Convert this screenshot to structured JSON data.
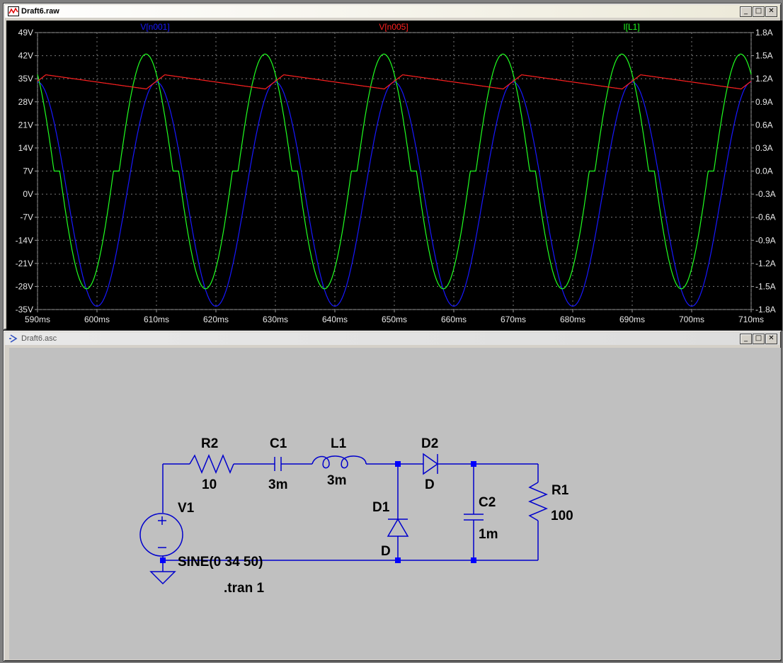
{
  "waveform_window": {
    "title": "Draft6.raw",
    "buttons": {
      "minimize": "_",
      "maximize": "□",
      "close": "✕"
    },
    "traces": [
      {
        "name": "V[n001]",
        "color": "#1818ff"
      },
      {
        "name": "V[n005]",
        "color": "#ff2020"
      },
      {
        "name": "I[L1]",
        "color": "#20ff20"
      }
    ],
    "chart_data": {
      "type": "line",
      "x_ticks": [
        "590ms",
        "600ms",
        "610ms",
        "620ms",
        "630ms",
        "640ms",
        "650ms",
        "660ms",
        "670ms",
        "680ms",
        "690ms",
        "700ms",
        "710ms"
      ],
      "xlim_ms": [
        590,
        710
      ],
      "left_ticks": [
        "49V",
        "42V",
        "35V",
        "28V",
        "21V",
        "14V",
        "7V",
        "0V",
        "-7V",
        "-14V",
        "-21V",
        "-28V",
        "-35V"
      ],
      "ylim_left_V": [
        -35,
        49
      ],
      "right_ticks": [
        "1.8A",
        "1.5A",
        "1.2A",
        "0.9A",
        "0.6A",
        "0.3A",
        "0.0A",
        "-0.3A",
        "-0.6A",
        "-0.9A",
        "-1.2A",
        "-1.5A",
        "-1.8A"
      ],
      "ylim_right_A": [
        -1.8,
        1.8
      ],
      "grid": true,
      "series": [
        {
          "name": "V[n001]",
          "axis": "left",
          "description": "sine 0 34 50Hz, amplitude 34V",
          "amplitude": 34,
          "offset": 0,
          "freq_hz": 50
        },
        {
          "name": "V[n005]",
          "axis": "left",
          "description": "ripple DC output",
          "peak": 36.2,
          "trough": 31.9
        },
        {
          "name": "I[L1]",
          "axis": "right",
          "description": "inductor current, clipped at 0",
          "peak": 1.52,
          "trough": -1.53
        }
      ]
    }
  },
  "schematic_window": {
    "title": "Draft6.asc",
    "buttons": {
      "minimize": "_",
      "maximize": "□",
      "close": "✕"
    },
    "components": {
      "R2": {
        "ref": "R2",
        "value": "10"
      },
      "C1": {
        "ref": "C1",
        "value": "3m"
      },
      "L1": {
        "ref": "L1",
        "value": "3m"
      },
      "D2": {
        "ref": "D2",
        "value": "D"
      },
      "D1": {
        "ref": "D1",
        "value": "D"
      },
      "C2": {
        "ref": "C2",
        "value": "1m"
      },
      "R1": {
        "ref": "R1",
        "value": "100"
      },
      "V1": {
        "ref": "V1",
        "value": "SINE(0 34 50)"
      }
    },
    "directive": ".tran 1",
    "wire_color": "#0000cc",
    "node_color": "#0000ff"
  }
}
